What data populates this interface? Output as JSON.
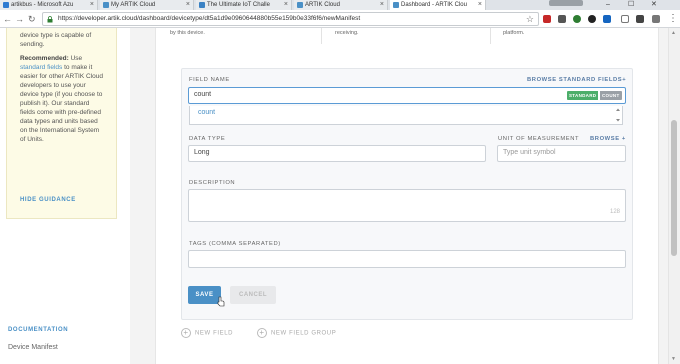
{
  "browser": {
    "tabs": [
      {
        "label": "artikbus - Microsoft Azu",
        "active": false,
        "color": "#2f7bd1"
      },
      {
        "label": "My ARTIK Cloud",
        "active": false,
        "color": "#4a90c6"
      },
      {
        "label": "The Ultimate IoT Challe",
        "active": false,
        "color": "#3b82c4"
      },
      {
        "label": "ARTIK Cloud",
        "active": false,
        "color": "#4a90c6"
      },
      {
        "label": "Dashboard - ARTIK Clou",
        "active": true,
        "color": "#4a90c6"
      }
    ],
    "url": "https://developer.artik.cloud/dashboard/devicetype/dt5a1d9e0960644880b55e159b0e33f6f6/newManifest"
  },
  "guidance": {
    "intro": "device type is capable of sending.",
    "recommended_label": "Recommended:",
    "recommended_pre": " Use ",
    "standard_fields_link": "standard fields",
    "recommended_post": " to make it easier for other ARTIK Cloud developers to use your device type (if you choose to publish it). Our standard fields come with pre-defined data types and units based on the International System of Units.",
    "hide_label": "HIDE GUIDANCE"
  },
  "sidebar": {
    "documentation_label": "DOCUMENTATION",
    "device_manifest_link": "Device Manifest"
  },
  "subtabs": {
    "col1": "by this device.",
    "col2": "receiving.",
    "col3": "platform."
  },
  "form": {
    "field_name_label": "FIELD NAME",
    "browse_standard_fields": "BROWSE STANDARD FIELDS+",
    "field_name_value": "count",
    "badge_standard": "STANDARD",
    "badge_count": "COUNT",
    "suggestion": "count",
    "data_type_label": "DATA TYPE",
    "data_type_value": "Long",
    "unit_label": "UNIT OF MEASUREMENT",
    "unit_browse": "BROWSE +",
    "unit_placeholder": "Type unit symbol",
    "description_label": "DESCRIPTION",
    "description_counter": "128",
    "tags_label": "TAGS (COMMA SEPARATED)",
    "save_label": "SAVE",
    "cancel_label": "CANCEL",
    "new_field_label": "NEW FIELD",
    "new_field_group_label": "NEW FIELD GROUP"
  }
}
